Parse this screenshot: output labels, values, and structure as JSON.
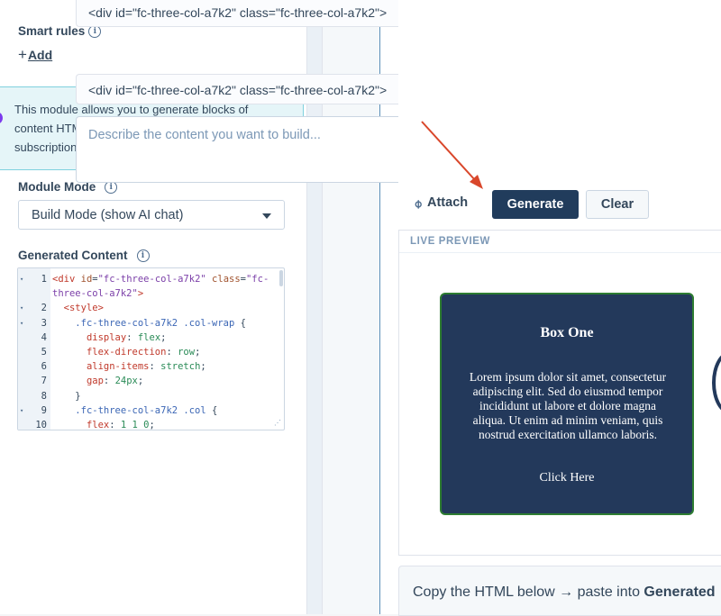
{
  "sidebar": {
    "smart_rules_label": "Smart rules",
    "info_glyph": "i",
    "add_plus": "+",
    "add_label": "Add",
    "notice_text": "This module allows you to generate blocks of content HTML via AI tools. Requires an active subscription.",
    "module_mode_label": "Module Mode",
    "module_mode_value": "Build Mode (show AI chat)",
    "generated_content_label": "Generated Content"
  },
  "editor": {
    "lines": [
      {
        "n": "1",
        "fold": "▾",
        "html": "<span class=\"c-tag\">&lt;div</span> <span class=\"c-attr\">id</span><span class=\"c-pun\">=</span><span class=\"c-str\">\"fc-three-col-a7k2\"</span> <span class=\"c-attr\">class</span><span class=\"c-pun\">=</span><span class=\"c-str\">\"fc-</span>"
      },
      {
        "n": "",
        "fold": "",
        "html": "<span class=\"c-str\">three-col-a7k2\"</span><span class=\"c-tag\">&gt;</span>"
      },
      {
        "n": "2",
        "fold": "▾",
        "html": "  <span class=\"c-tag\">&lt;style&gt;</span>"
      },
      {
        "n": "3",
        "fold": "▾",
        "html": "    <span class=\"c-sel\">.fc-three-col-a7k2 .col-wrap</span> <span class=\"c-pun\">{</span>"
      },
      {
        "n": "4",
        "fold": "",
        "html": "      <span class=\"c-prop\">display</span><span class=\"c-pun\">:</span> <span class=\"c-val\">flex</span><span class=\"c-pun\">;</span>"
      },
      {
        "n": "5",
        "fold": "",
        "html": "      <span class=\"c-prop\">flex-direction</span><span class=\"c-pun\">:</span> <span class=\"c-val\">row</span><span class=\"c-pun\">;</span>"
      },
      {
        "n": "6",
        "fold": "",
        "html": "      <span class=\"c-prop\">align-items</span><span class=\"c-pun\">:</span> <span class=\"c-val\">stretch</span><span class=\"c-pun\">;</span>"
      },
      {
        "n": "7",
        "fold": "",
        "html": "      <span class=\"c-prop\">gap</span><span class=\"c-pun\">:</span> <span class=\"c-val\">24px</span><span class=\"c-pun\">;</span>"
      },
      {
        "n": "8",
        "fold": "",
        "html": "    <span class=\"c-pun\">}</span>"
      },
      {
        "n": "9",
        "fold": "▾",
        "html": "    <span class=\"c-sel\">.fc-three-col-a7k2 .col</span> <span class=\"c-pun\">{</span>"
      },
      {
        "n": "10",
        "fold": "",
        "html": "      <span class=\"c-prop\">flex</span><span class=\"c-pun\">:</span> <span class=\"c-val\">1 1 0</span><span class=\"c-pun\">;</span>"
      }
    ]
  },
  "builder": {
    "code_row_1": "<div id=\"fc-three-col-a7k2\" class=\"fc-three-col-a7k2\">",
    "code_row_2": "<div id=\"fc-three-col-a7k2\" class=\"fc-three-col-a7k2\">",
    "prompt_placeholder": "Describe the content you want to build...",
    "attach_label": "Attach",
    "generate_label": "Generate",
    "clear_label": "Clear",
    "preview_label": "LIVE PREVIEW",
    "card": {
      "title": "Box One",
      "body": "Lorem ipsum dolor sit amet, consectetur adipiscing elit. Sed do eiusmod tempor incididunt ut labore et dolore magna aliqua. Ut enim ad minim veniam, quis nostrud exercitation ullamco laboris.",
      "link": "Click Here"
    },
    "copy_text_prefix": "Copy the HTML below → paste into ",
    "copy_text_bold": "Generated"
  },
  "colors": {
    "navy": "#213c5c",
    "card_bg": "#23395b",
    "card_border": "#2e7d32",
    "notice_bg": "#e5f5f8",
    "notice_accent": "#7c3aed",
    "annotation_arrow": "#d9472b"
  },
  "icons": [
    "info-icon",
    "plus-icon",
    "chevron-down-icon",
    "paperclip-icon",
    "resize-handle-icon",
    "annotation-arrow"
  ]
}
